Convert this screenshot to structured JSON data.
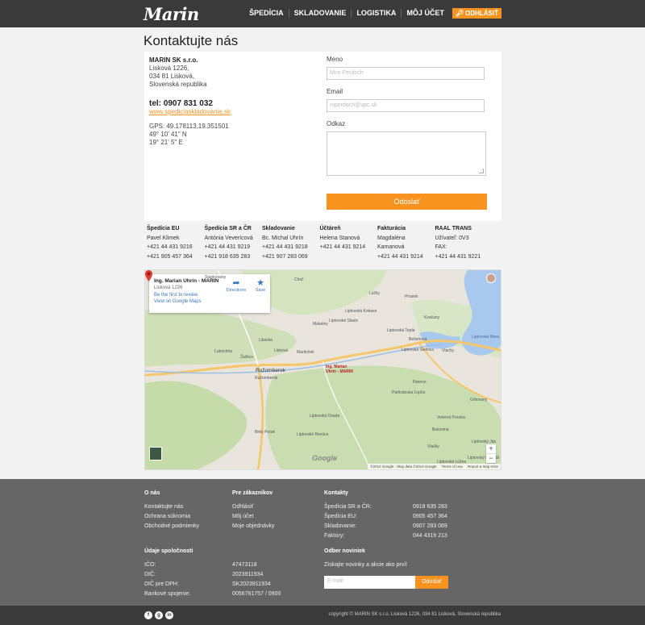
{
  "header": {
    "logo": "Marin",
    "nav": [
      "ŠPEDÍCIA",
      "SKLADOVANIE",
      "LOGISTIKA",
      "MÔJ ÚČET"
    ],
    "logout": "ODHLÁSIŤ"
  },
  "page_title": "Kontaktujte nás",
  "address": {
    "company": "MARIN SK s.r.o.",
    "street": "Lisková 1226,",
    "city": "034 81 Lisková,",
    "country": "Slovenská republika",
    "phone": "tel: 0907 831 032",
    "web": "www.spediciaskladovanie.sk",
    "gps": "GPS: 49.178113,19.351501",
    "lat": "49° 10' 41\" N",
    "lon": "19° 21' 5\" E"
  },
  "form": {
    "name_label": "Meno",
    "name_value": "Miro Perdoch",
    "email_label": "Email",
    "email_value": "mperdoch@upc.sk",
    "message_label": "Odkaz",
    "submit": "Odoslať"
  },
  "contacts": [
    {
      "title": "Špedícia EU",
      "lines": [
        "Pavel Klimek",
        "+421 44 431 9216",
        "+421 905 457 364"
      ]
    },
    {
      "title": "Špedícia SR a ČR",
      "lines": [
        "Antónia Veverícová",
        "+421 44 431 9219",
        "+421 918 635 283"
      ]
    },
    {
      "title": "Skladovanie",
      "lines": [
        "Bc. Michal Uhrín",
        "+421 44 431 9218",
        "+421 907 283 069"
      ]
    },
    {
      "title": "Účtáreň",
      "lines": [
        "Helena Stanová",
        "+421 44 431 9214",
        ""
      ]
    },
    {
      "title": "Fakturácia",
      "lines": [
        "Magdaléna",
        "Kamanová",
        "+421 44 431 9214"
      ]
    },
    {
      "title": "RAAL TRANS",
      "lines": [
        "Užívateľ: 0V3",
        "FAX:",
        "+421 44 431 9221"
      ]
    }
  ],
  "map": {
    "card_name": "Ing. Marian Uhrín - MARIN",
    "card_address": "Lisková 1226",
    "card_review": "Be the first to review",
    "card_view": "View on Google Maps",
    "directions": "Directions",
    "save": "Save",
    "pin_label_1": "Ing. Marian",
    "pin_label_2": "Uhrín - MARIN",
    "google": "Google",
    "footer_data": "©2014 Google · Map data ©2014 Google",
    "footer_terms": "Terms of Use",
    "footer_report": "Report a map error",
    "zoom_in": "+",
    "zoom_out": "−",
    "places": [
      "Ružomberok",
      "Ružomberok",
      "Lisková",
      "Liptovská Teplá",
      "Choč",
      "Lúčky",
      "Liptovská Mara",
      "Bešeňová",
      "Vlachy",
      "Partizánska Ľupča",
      "Liptovská Osada",
      "Liptovské Revúce",
      "Liptovská Lúžna",
      "Biely Potok",
      "Stankovany",
      "Likavka",
      "Martinček",
      "Žaškov",
      "Ľubochňa",
      "Malatíny",
      "Liptovské Sliače",
      "Liptovská Kokava",
      "Gôtovany",
      "Veterná Poruba",
      "Bukovina",
      "Liptovský Mikuláš",
      "Vlašky",
      "Liptovská Sielnica",
      "Iľanovo",
      "Liptovský Ján",
      "Prosiek",
      "Kvačany"
    ]
  },
  "footer": {
    "about_title": "O nás",
    "about": [
      "Kontaktujte nás",
      "Ochrana súkromia",
      "Obchodné podmienky"
    ],
    "customers_title": "Pre zákazníkov",
    "customers": [
      "Odhlásiť",
      "Môj účet",
      "Moje objednávky"
    ],
    "contacts_title": "Kontakty",
    "contact_labels": [
      "Špedícia SR a ČR:",
      "Špedícia EU:",
      "Skladovanie:",
      "Faktúry:"
    ],
    "contact_values": [
      "0918 635 283",
      "0905 457 364",
      "0907 283 069",
      "044 4319 213"
    ],
    "company_title": "Údaje spoločnosti",
    "company_labels": [
      "IČO:",
      "DIČ:",
      "DIČ pre DPH:",
      "Bankové spojenie:"
    ],
    "company_values": [
      "47473118",
      "2023911934",
      "SK2023911934",
      "0056761757 / 0900"
    ],
    "news_title": "Odber noviniek",
    "news_text": "Získajte novinky a akcie ako prví!",
    "news_placeholder": "E-mail",
    "news_button": "Odoslať",
    "social": [
      "f",
      "g",
      "in"
    ],
    "copyright": "copyright © MARIN SK s.r.o. Lisková 1226, 034 81 Lisková, Slovenská republika"
  },
  "colors": {
    "accent": "#f7931e",
    "topbar": "#3a3a3a",
    "footer": "#666666"
  }
}
